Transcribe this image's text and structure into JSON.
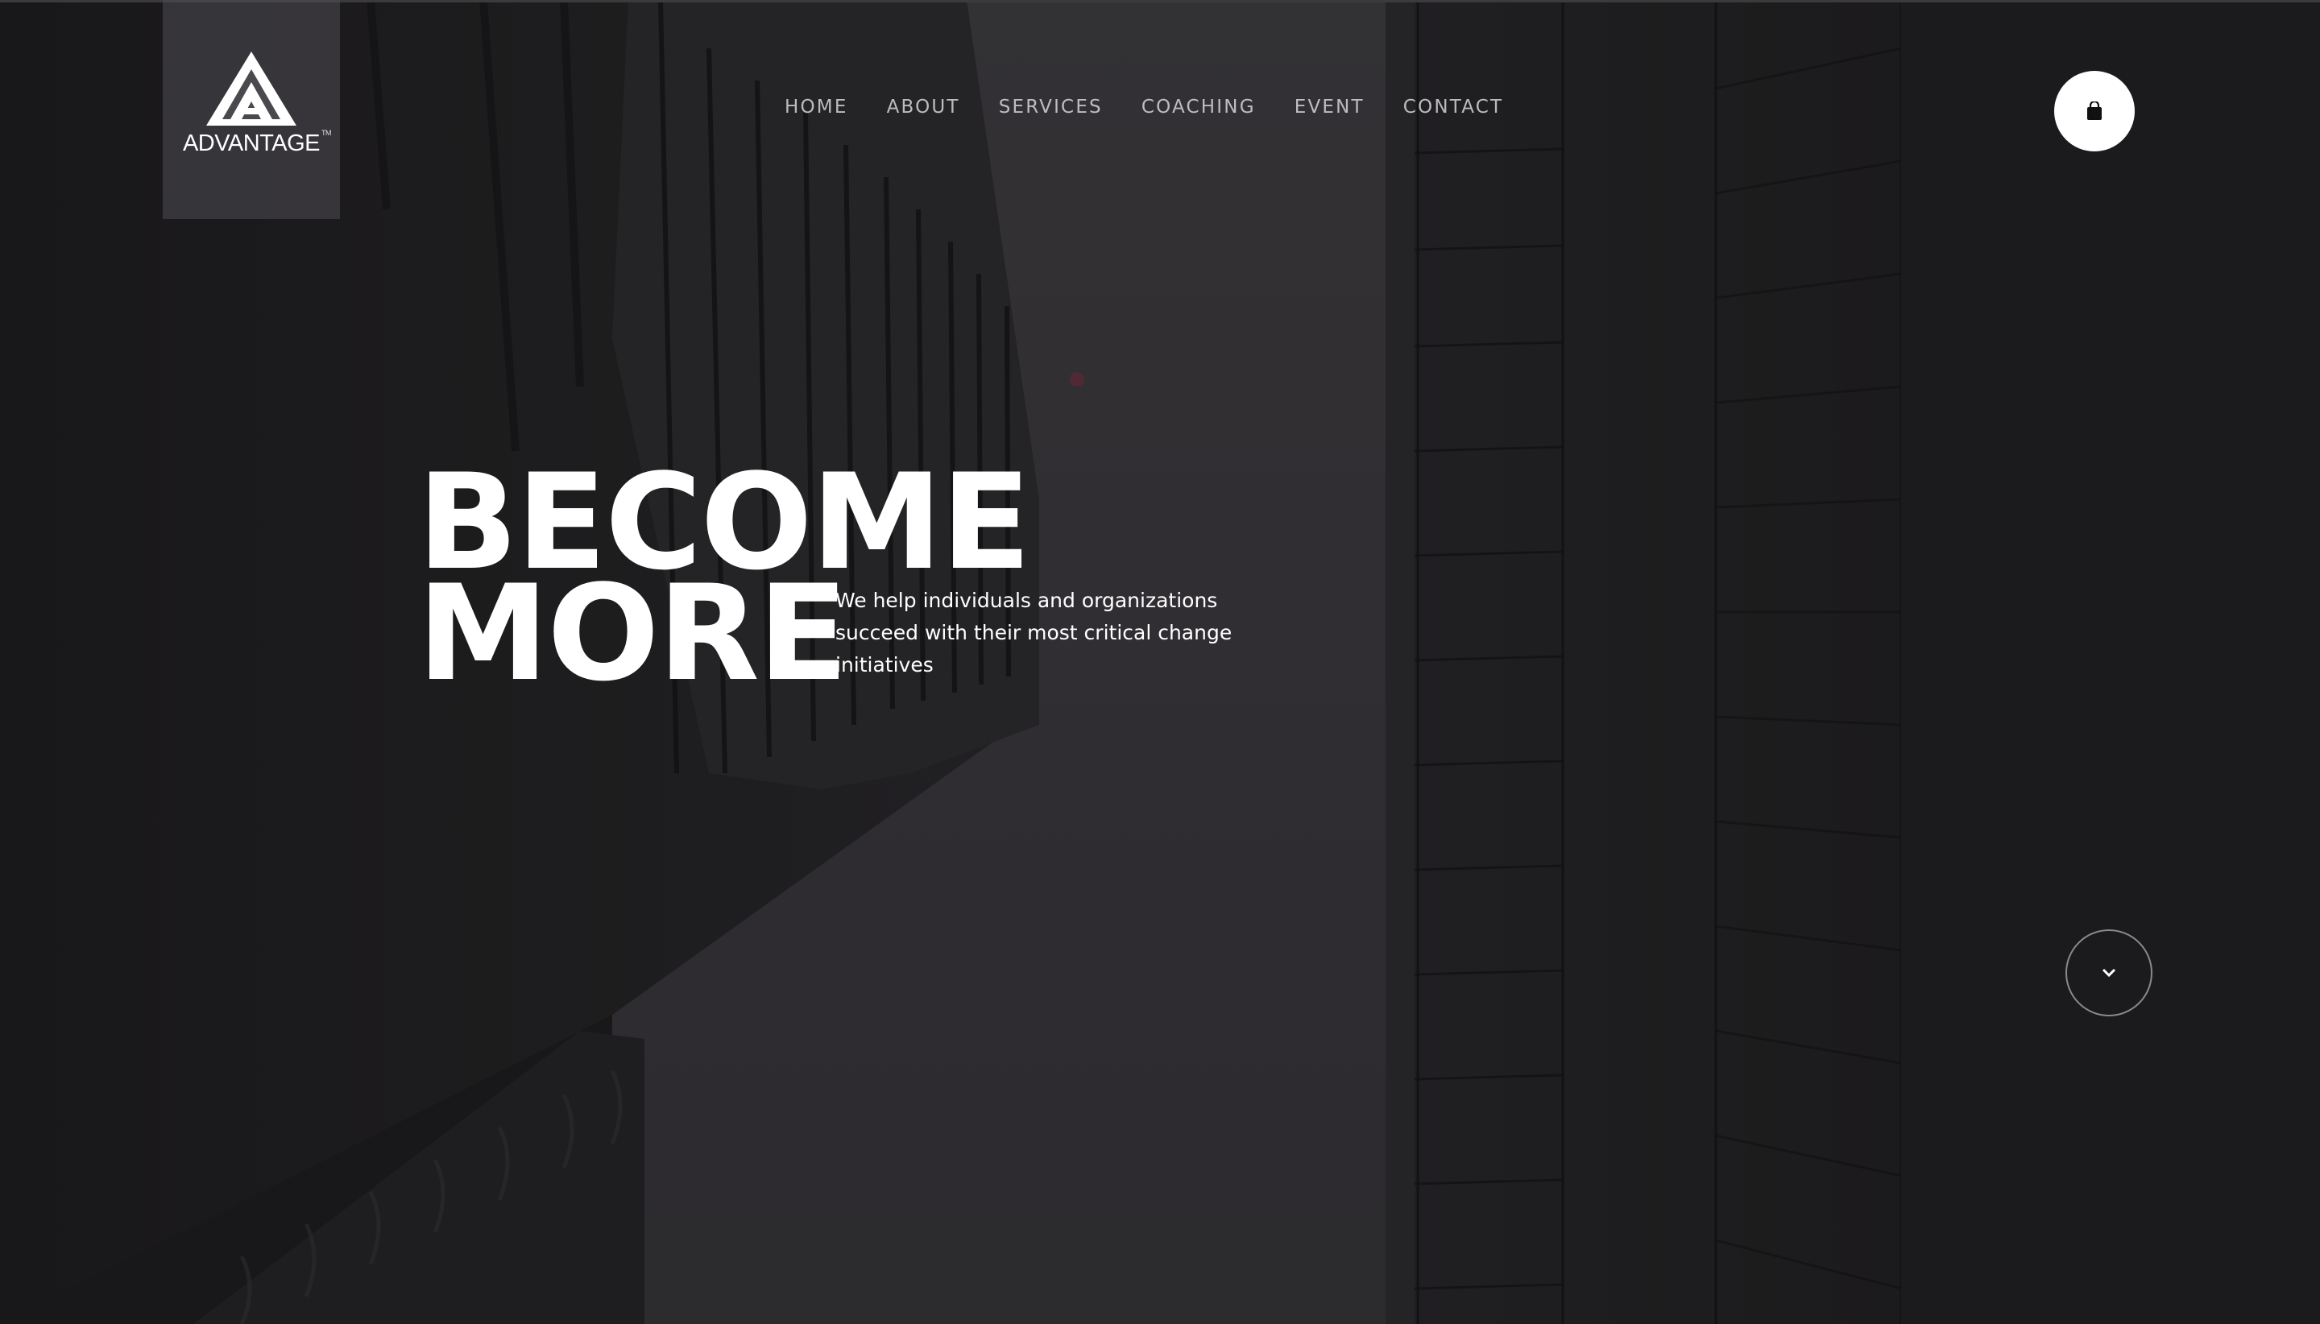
{
  "brand": {
    "name": "ADVANTAGE",
    "trademark": "TM",
    "logo_icon": "triangle-a-icon"
  },
  "nav": {
    "items": [
      {
        "label": "HOME"
      },
      {
        "label": "ABOUT"
      },
      {
        "label": "SERVICES"
      },
      {
        "label": "COACHING"
      },
      {
        "label": "EVENT"
      },
      {
        "label": "CONTACT"
      }
    ]
  },
  "header": {
    "cart_icon": "shopping-bag-icon"
  },
  "hero": {
    "title_line1": "BECOME",
    "title_line2": "MORE",
    "subtitle": "We help individuals and organizations succeed with their most critical change initiatives",
    "scroll_icon": "chevron-down-icon"
  },
  "colors": {
    "background": "#1d1c1e",
    "text": "#ffffff",
    "nav_text": "#c9c8cc",
    "logo_panel": "#4e4d52"
  }
}
